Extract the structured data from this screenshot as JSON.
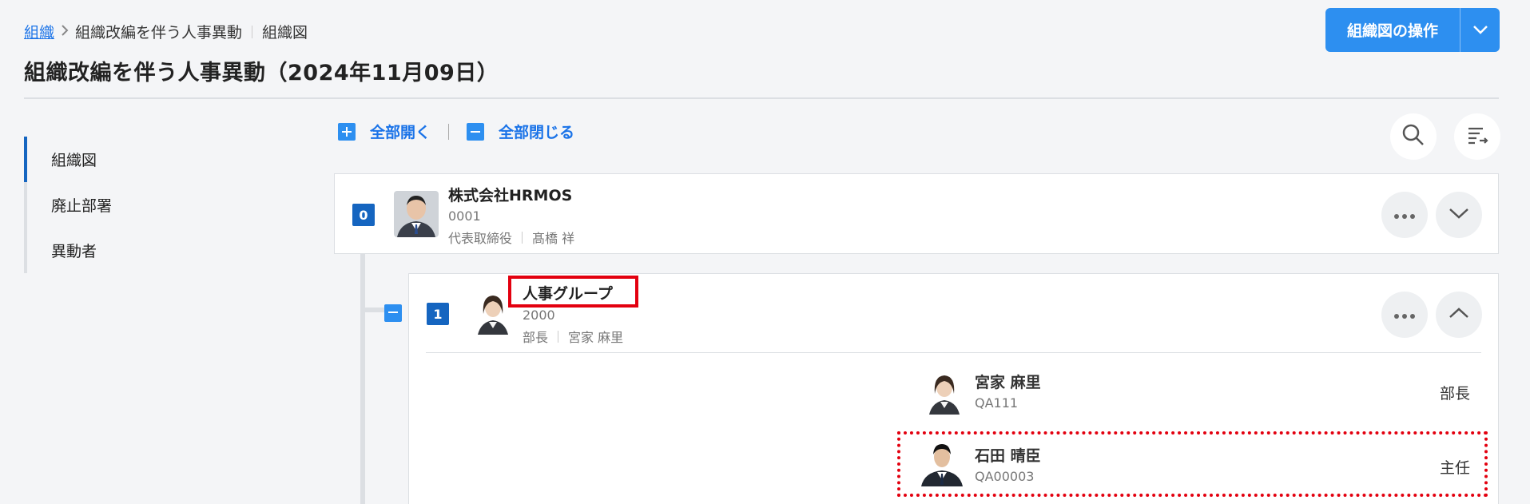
{
  "breadcrumb": {
    "root": "組織",
    "current": "組織改編を伴う人事異動",
    "sub": "組織図"
  },
  "page_title": "組織改編を伴う人事異動（2024年11月09日）",
  "header": {
    "ops_button_label": "組織図の操作"
  },
  "sidebar": {
    "items": [
      {
        "label": "組織図",
        "active": true
      },
      {
        "label": "廃止部署",
        "active": false
      },
      {
        "label": "異動者",
        "active": false
      }
    ]
  },
  "toolbar": {
    "expand_all": "全部開く",
    "collapse_all": "全部閉じる"
  },
  "orgs": [
    {
      "level": "0",
      "name": "株式会社HRMOS",
      "code": "0001",
      "head_title": "代表取締役",
      "head_name": "髙橋 祥"
    },
    {
      "level": "1",
      "name": "人事グループ",
      "code": "2000",
      "head_title": "部長",
      "head_name": "宮家 麻里"
    }
  ],
  "members": [
    {
      "name": "宮家 麻里",
      "code": "QA111",
      "position": "部長"
    },
    {
      "name": "石田 晴臣",
      "code": "QA00003",
      "position": "主任"
    }
  ],
  "icons": {
    "accent": "#2d8ff0",
    "badge": "#1565c0",
    "highlight": "#e3000f"
  }
}
